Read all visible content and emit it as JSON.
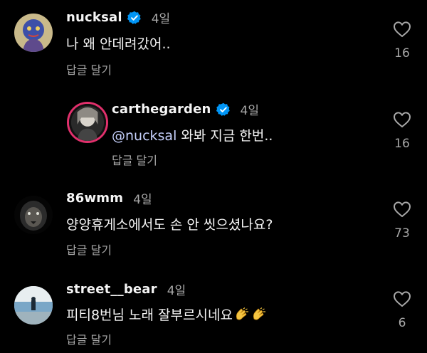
{
  "comments": [
    {
      "username": "nucksal",
      "verified": true,
      "time": "4일",
      "text": "나 왜 안데려갔어..",
      "reply_label": "답글 달기",
      "likes": "16"
    },
    {
      "username": "carthegarden",
      "verified": true,
      "time": "4일",
      "mention": "@nucksal",
      "text": " 와봐 지금 한번..",
      "reply_label": "답글 달기",
      "likes": "16"
    },
    {
      "username": "86wmm",
      "verified": false,
      "time": "4일",
      "text": "양양휴게소에서도 손 안 씻으셨나요?",
      "reply_label": "답글 달기",
      "likes": "73"
    },
    {
      "username": "street__bear",
      "verified": false,
      "time": "4일",
      "text": "피티8번님 노래 잘부르시네요",
      "emoji": "clapping-hands-emoji",
      "reply_label": "답글 달기",
      "likes": "6"
    }
  ],
  "icons": {
    "verified": "verified-badge-icon",
    "like": "heart-outline-icon"
  },
  "colors": {
    "background": "#000000",
    "verified_blue": "#0095f6",
    "secondary_text": "#a8a8a8",
    "story_ring": "#e1306c"
  }
}
